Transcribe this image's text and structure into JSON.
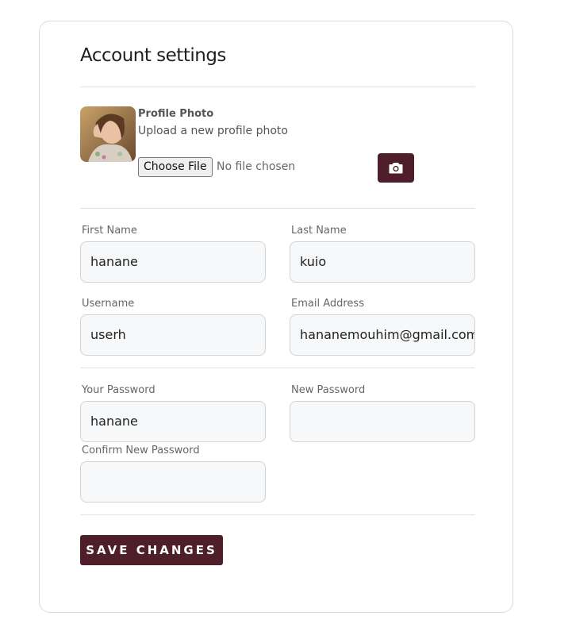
{
  "page": {
    "title": "Account settings"
  },
  "profile_photo": {
    "label": "Profile Photo",
    "hint": "Upload a new profile photo",
    "choose_file_label": "Choose File",
    "no_file_text": "No file chosen",
    "camera_icon": "camera-icon"
  },
  "fields": {
    "first_name": {
      "label": "First Name",
      "value": "hanane"
    },
    "last_name": {
      "label": "Last Name",
      "value": "kuio"
    },
    "username": {
      "label": "Username",
      "value": "userh"
    },
    "email": {
      "label": "Email Address",
      "value": "hananemouhim@gmail.com"
    },
    "your_password": {
      "label": "Your Password",
      "value": "hanane"
    },
    "new_password": {
      "label": "New Password",
      "value": ""
    },
    "confirm_new_password": {
      "label": "Confirm New Password",
      "value": ""
    }
  },
  "actions": {
    "save_label": "SAVE CHANGES"
  },
  "colors": {
    "accent": "#4e1f2b",
    "input_bg": "#f7f8f9",
    "border": "#d3d3d3"
  }
}
